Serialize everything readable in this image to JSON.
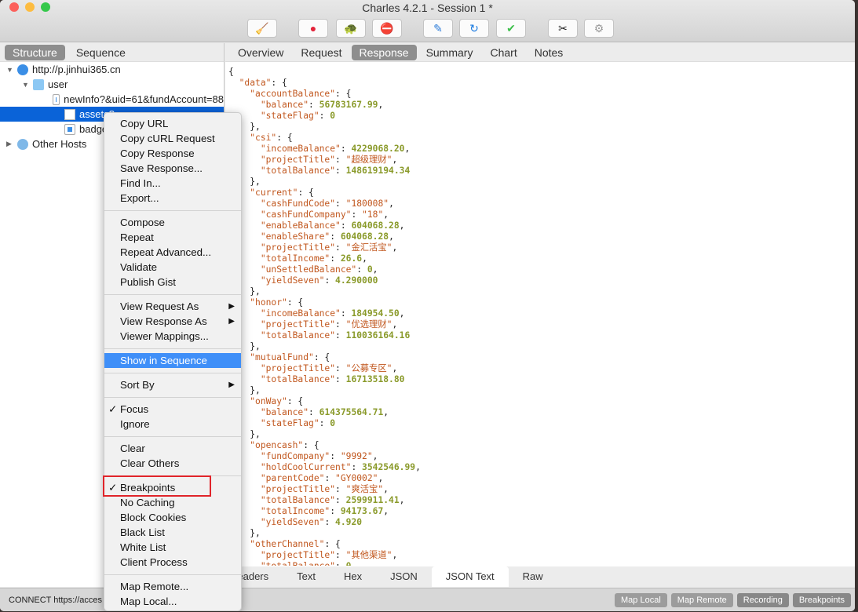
{
  "window": {
    "title": "Charles 4.2.1 - Session 1 *"
  },
  "toolbar": [
    {
      "name": "broom-icon",
      "glyph": "🧹"
    },
    {
      "name": "record-icon",
      "glyph": "●",
      "color": "#e3233a"
    },
    {
      "name": "throttle-turtle-icon",
      "glyph": "🐢"
    },
    {
      "name": "breakpoint-stop-icon",
      "glyph": "⛔"
    },
    {
      "name": "compose-pen-icon",
      "glyph": "✎",
      "color": "#2a7ad8"
    },
    {
      "name": "repeat-refresh-icon",
      "glyph": "↻",
      "color": "#1a7ae0"
    },
    {
      "name": "validate-check-icon",
      "glyph": "✔",
      "color": "#3cbf4a"
    },
    {
      "name": "tools-icon",
      "glyph": "✂"
    },
    {
      "name": "settings-gear-icon",
      "glyph": "⚙",
      "color": "#999"
    }
  ],
  "left": {
    "tabs": [
      "Structure",
      "Sequence"
    ],
    "selected_tab": "Structure",
    "tree": [
      {
        "label": "http://p.jinhui365.cn",
        "level": 0,
        "icon": "globe-icon",
        "expanded": true
      },
      {
        "label": "user",
        "level": 1,
        "icon": "folder-icon",
        "expanded": true
      },
      {
        "label": "newInfo?&uid=61&fundAccount=88",
        "level": 2,
        "icon": "request-icon"
      },
      {
        "label": "assets?a",
        "level": 2,
        "icon": "document-icon",
        "selected": true
      },
      {
        "label": "badge?&",
        "level": 2,
        "icon": "request-icon"
      },
      {
        "label": "Other Hosts",
        "level": 0,
        "icon": "hosts-icon",
        "expanded": false
      }
    ]
  },
  "right": {
    "tabs": [
      "Overview",
      "Request",
      "Response",
      "Summary",
      "Chart",
      "Notes"
    ],
    "selected_tab": "Response",
    "bottom_tabs": [
      "Headers",
      "Text",
      "Hex",
      "JSON",
      "JSON Text",
      "Raw"
    ],
    "selected_bottom_tab": "JSON Text",
    "json_lines": [
      [
        "0",
        "{"
      ],
      [
        "1",
        "\"data\"",
        ": {"
      ],
      [
        "2",
        "\"accountBalance\"",
        ": {"
      ],
      [
        "3",
        "\"balance\"",
        ": ",
        "n56783167.99",
        ","
      ],
      [
        "3",
        "\"stateFlag\"",
        ": ",
        "n0",
        ""
      ],
      [
        "2",
        "},"
      ],
      [
        "2",
        "\"csi\"",
        ": {"
      ],
      [
        "3",
        "\"incomeBalance\"",
        ": ",
        "n4229068.20",
        ","
      ],
      [
        "3",
        "\"projectTitle\"",
        ": ",
        "s\"超级理财\"",
        ","
      ],
      [
        "3",
        "\"totalBalance\"",
        ": ",
        "n148619194.34",
        ""
      ],
      [
        "2",
        "},"
      ],
      [
        "2",
        "\"current\"",
        ": {"
      ],
      [
        "3",
        "\"cashFundCode\"",
        ": ",
        "s\"180008\"",
        ","
      ],
      [
        "3",
        "\"cashFundCompany\"",
        ": ",
        "s\"18\"",
        ","
      ],
      [
        "3",
        "\"enableBalance\"",
        ": ",
        "n604068.28",
        ","
      ],
      [
        "3",
        "\"enableShare\"",
        ": ",
        "n604068.28",
        ","
      ],
      [
        "3",
        "\"projectTitle\"",
        ": ",
        "s\"金汇活宝\"",
        ","
      ],
      [
        "3",
        "\"totalIncome\"",
        ": ",
        "n26.6",
        ","
      ],
      [
        "3",
        "\"unSettledBalance\"",
        ": ",
        "n0",
        ","
      ],
      [
        "3",
        "\"yieldSeven\"",
        ": ",
        "n4.290000",
        ""
      ],
      [
        "2",
        "},"
      ],
      [
        "2",
        "\"honor\"",
        ": {"
      ],
      [
        "3",
        "\"incomeBalance\"",
        ": ",
        "n184954.50",
        ","
      ],
      [
        "3",
        "\"projectTitle\"",
        ": ",
        "s\"优选理财\"",
        ","
      ],
      [
        "3",
        "\"totalBalance\"",
        ": ",
        "n110036164.16",
        ""
      ],
      [
        "2",
        "},"
      ],
      [
        "2",
        "\"mutualFund\"",
        ": {"
      ],
      [
        "3",
        "\"projectTitle\"",
        ": ",
        "s\"公募专区\"",
        ","
      ],
      [
        "3",
        "\"totalBalance\"",
        ": ",
        "n16713518.80",
        ""
      ],
      [
        "2",
        "},"
      ],
      [
        "2",
        "\"onWay\"",
        ": {"
      ],
      [
        "3",
        "\"balance\"",
        ": ",
        "n614375564.71",
        ","
      ],
      [
        "3",
        "\"stateFlag\"",
        ": ",
        "n0",
        ""
      ],
      [
        "2",
        "},"
      ],
      [
        "2",
        "\"opencash\"",
        ": {"
      ],
      [
        "3",
        "\"fundCompany\"",
        ": ",
        "s\"9992\"",
        ","
      ],
      [
        "3",
        "\"holdCoolCurrent\"",
        ": ",
        "n3542546.99",
        ","
      ],
      [
        "3",
        "\"parentCode\"",
        ": ",
        "s\"GY0002\"",
        ","
      ],
      [
        "3",
        "\"projectTitle\"",
        ": ",
        "s\"爽活宝\"",
        ","
      ],
      [
        "3",
        "\"totalBalance\"",
        ": ",
        "n2599911.41",
        ","
      ],
      [
        "3",
        "\"totalIncome\"",
        ": ",
        "n94173.67",
        ","
      ],
      [
        "3",
        "\"yieldSeven\"",
        ": ",
        "n4.920",
        ""
      ],
      [
        "2",
        "},"
      ],
      [
        "2",
        "\"otherChannel\"",
        ": {"
      ],
      [
        "3",
        "\"projectTitle\"",
        ": ",
        "s\"其他渠道\"",
        ","
      ],
      [
        "3",
        "\"totalBalance\"",
        ": ",
        "n0",
        ""
      ]
    ]
  },
  "context_menu": {
    "groups": [
      [
        {
          "label": "Copy URL"
        },
        {
          "label": "Copy cURL Request"
        },
        {
          "label": "Copy Response"
        },
        {
          "label": "Save Response..."
        },
        {
          "label": "Find In..."
        },
        {
          "label": "Export..."
        }
      ],
      [
        {
          "label": "Compose"
        },
        {
          "label": "Repeat"
        },
        {
          "label": "Repeat Advanced..."
        },
        {
          "label": "Validate"
        },
        {
          "label": "Publish Gist"
        }
      ],
      [
        {
          "label": "View Request As",
          "submenu": true
        },
        {
          "label": "View Response As",
          "submenu": true
        },
        {
          "label": "Viewer Mappings..."
        }
      ],
      [
        {
          "label": "Show in Sequence",
          "highlighted": true
        }
      ],
      [
        {
          "label": "Sort By",
          "submenu": true
        }
      ],
      [
        {
          "label": "Focus",
          "checked": true
        },
        {
          "label": "Ignore"
        }
      ],
      [
        {
          "label": "Clear"
        },
        {
          "label": "Clear Others"
        }
      ],
      [
        {
          "label": "Breakpoints",
          "checked": true,
          "annotated": true
        },
        {
          "label": "No Caching"
        },
        {
          "label": "Block Cookies"
        },
        {
          "label": "Black List"
        },
        {
          "label": "White List"
        },
        {
          "label": "Client Process"
        }
      ],
      [
        {
          "label": "Map Remote..."
        },
        {
          "label": "Map Local..."
        }
      ]
    ]
  },
  "status": {
    "text": "CONNECT https://acces",
    "buttons": [
      "Map Local",
      "Map Remote",
      "Recording",
      "Breakpoints"
    ]
  },
  "colors": {
    "selection": "#0a63d8",
    "menu_highlight": "#3f8ff8",
    "annotation": "#e0242a",
    "json_key": "#c1571e",
    "json_number": "#8a9a2a"
  }
}
